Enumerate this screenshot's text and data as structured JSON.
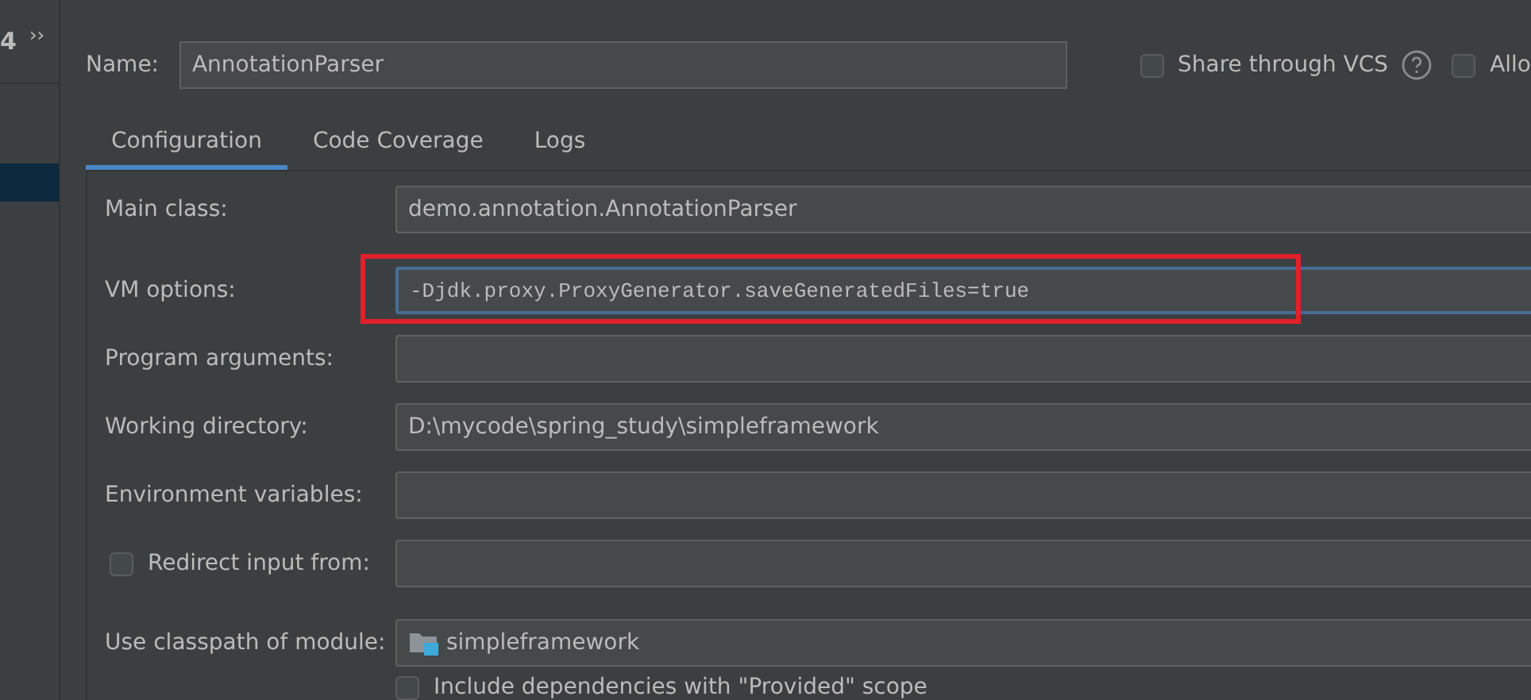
{
  "sidebar": {
    "cut_label": "4",
    "more_button": "››",
    "items": [
      {
        "selected": true
      }
    ]
  },
  "name_field": {
    "label": "Name:",
    "value": "AnnotationParser"
  },
  "header_options": [
    {
      "label": "Share through VCS",
      "checked": false,
      "help": true
    },
    {
      "label": "Allo",
      "checked": false
    }
  ],
  "tabs": [
    {
      "label": "Configuration",
      "selected": true
    },
    {
      "label": "Code Coverage",
      "selected": false
    },
    {
      "label": "Logs",
      "selected": false
    }
  ],
  "form": [
    {
      "kind": "text",
      "label": "Main class:",
      "value": "demo.annotation.AnnotationParser"
    },
    {
      "kind": "code",
      "label": "VM options:",
      "value": "-Djdk.proxy.ProxyGenerator.saveGeneratedFiles=true",
      "focused": true,
      "highlighted": true
    },
    {
      "kind": "text",
      "label": "Program arguments:"
    },
    {
      "kind": "text",
      "label": "Working directory:",
      "value": "D:\\mycode\\spring_study\\simpleframework"
    },
    {
      "kind": "text",
      "label": "Environment variables:"
    },
    {
      "kind": "checkbox-text",
      "label": "Redirect input from:",
      "checked": false
    },
    {
      "kind": "module",
      "label": "Use classpath of module:",
      "value": "simpleframework"
    },
    {
      "kind": "checkbox",
      "label": "Include dependencies with \"Provided\" scope",
      "checked": false
    }
  ]
}
